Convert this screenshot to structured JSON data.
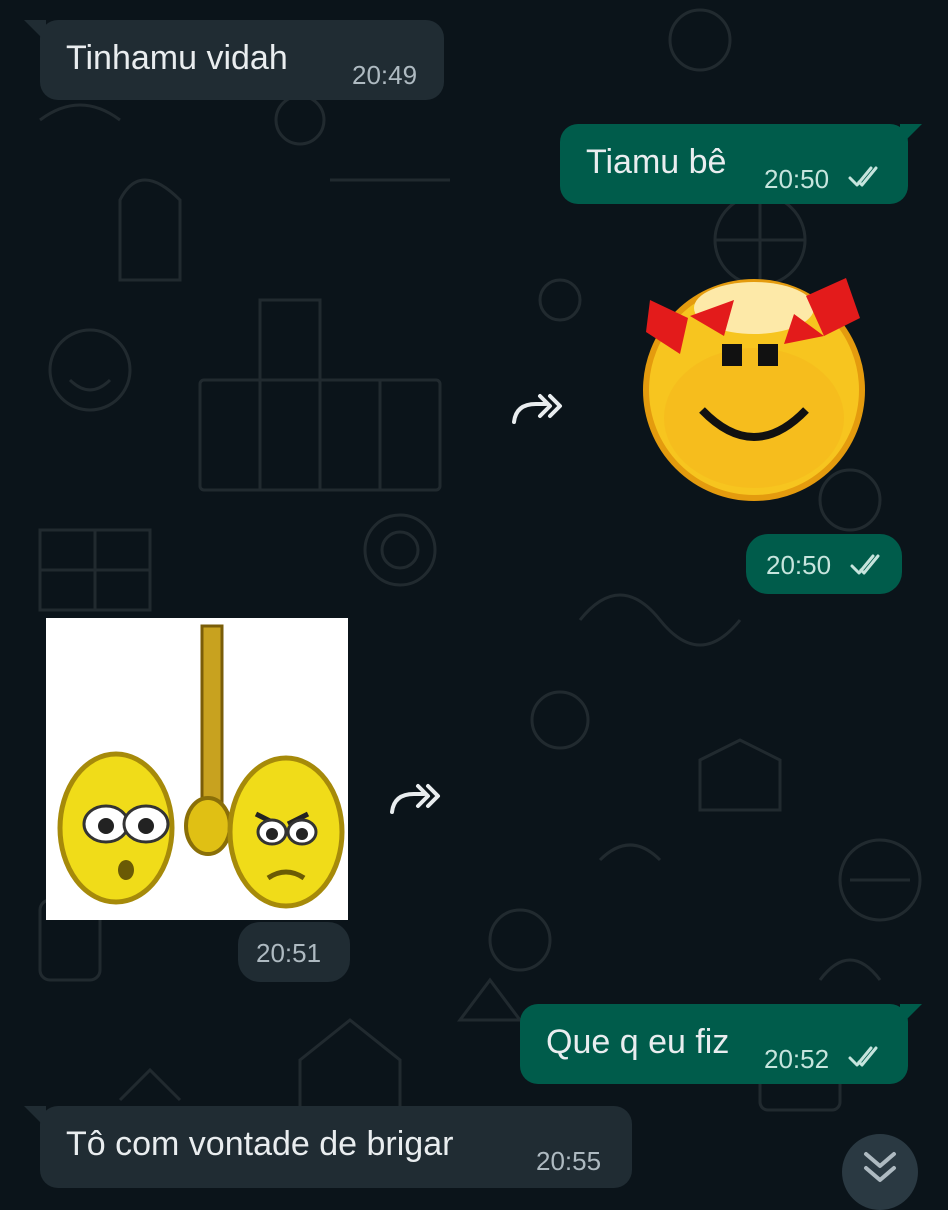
{
  "messages": [
    {
      "direction": "incoming",
      "type": "text",
      "text": "Tinhamu vidah",
      "time": "20:49"
    },
    {
      "direction": "outgoing",
      "type": "text",
      "text": "Tiamu bê",
      "time": "20:50",
      "status": "read"
    },
    {
      "direction": "outgoing",
      "type": "sticker",
      "sticker": "smiley-with-red-bows",
      "time": "20:50",
      "status": "read"
    },
    {
      "direction": "incoming",
      "type": "sticker",
      "sticker": "two-smileys-with-bat",
      "time": "20:51"
    },
    {
      "direction": "outgoing",
      "type": "text",
      "text": "Que q eu fiz",
      "time": "20:52",
      "status": "read"
    },
    {
      "direction": "incoming",
      "type": "text",
      "text": "Tô com vontade de brigar",
      "time": "20:55"
    }
  ],
  "icons": {
    "forward": "forward-icon",
    "read_ticks": "double-check-icon",
    "scroll_down": "chevron-double-down-icon"
  },
  "colors": {
    "background": "#0b141a",
    "incoming_bubble": "#202c33",
    "outgoing_bubble": "#005c4b",
    "text": "#e9edef",
    "read_tick": "#c6e4dd"
  }
}
